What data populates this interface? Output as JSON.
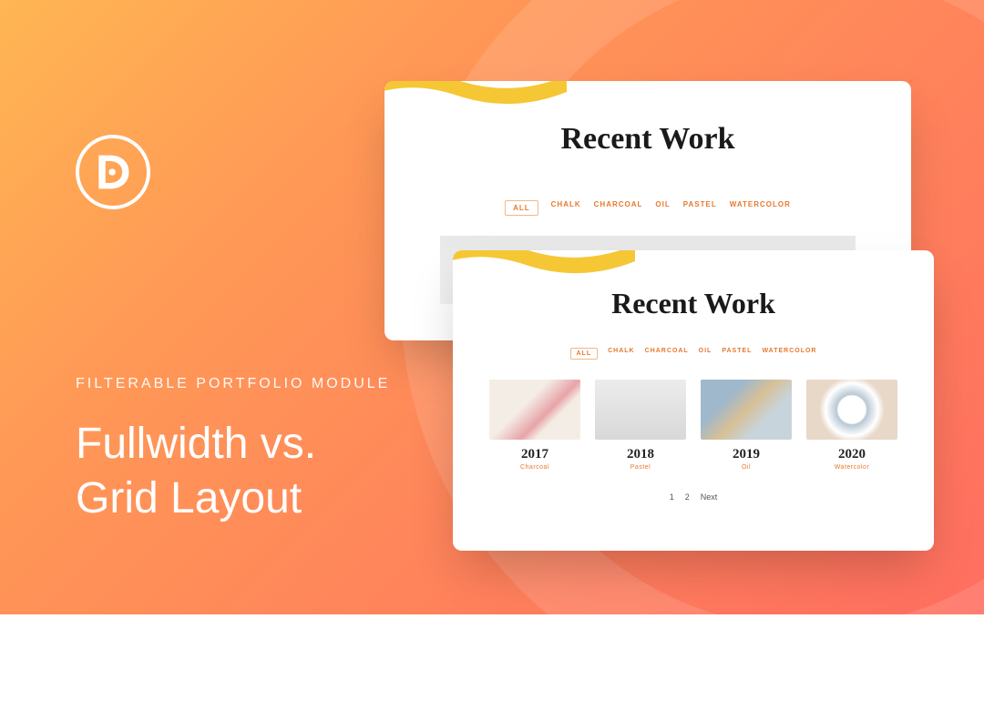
{
  "eyebrow": "FILTERABLE PORTFOLIO MODULE",
  "headline_line1": "Fullwidth vs.",
  "headline_line2": "Grid Layout",
  "logo_letter": "D",
  "card_back": {
    "title": "Recent Work",
    "filters": [
      "ALL",
      "CHALK",
      "CHARCOAL",
      "OIL",
      "PASTEL",
      "WATERCOLOR"
    ]
  },
  "card_front": {
    "title": "Recent Work",
    "filters": [
      "ALL",
      "CHALK",
      "CHARCOAL",
      "OIL",
      "PASTEL",
      "WATERCOLOR"
    ],
    "items": [
      {
        "year": "2017",
        "category": "Charcoal"
      },
      {
        "year": "2018",
        "category": "Pastel"
      },
      {
        "year": "2019",
        "category": "Oil"
      },
      {
        "year": "2020",
        "category": "Watercolor"
      }
    ],
    "pager": [
      "1",
      "2",
      "Next"
    ]
  }
}
